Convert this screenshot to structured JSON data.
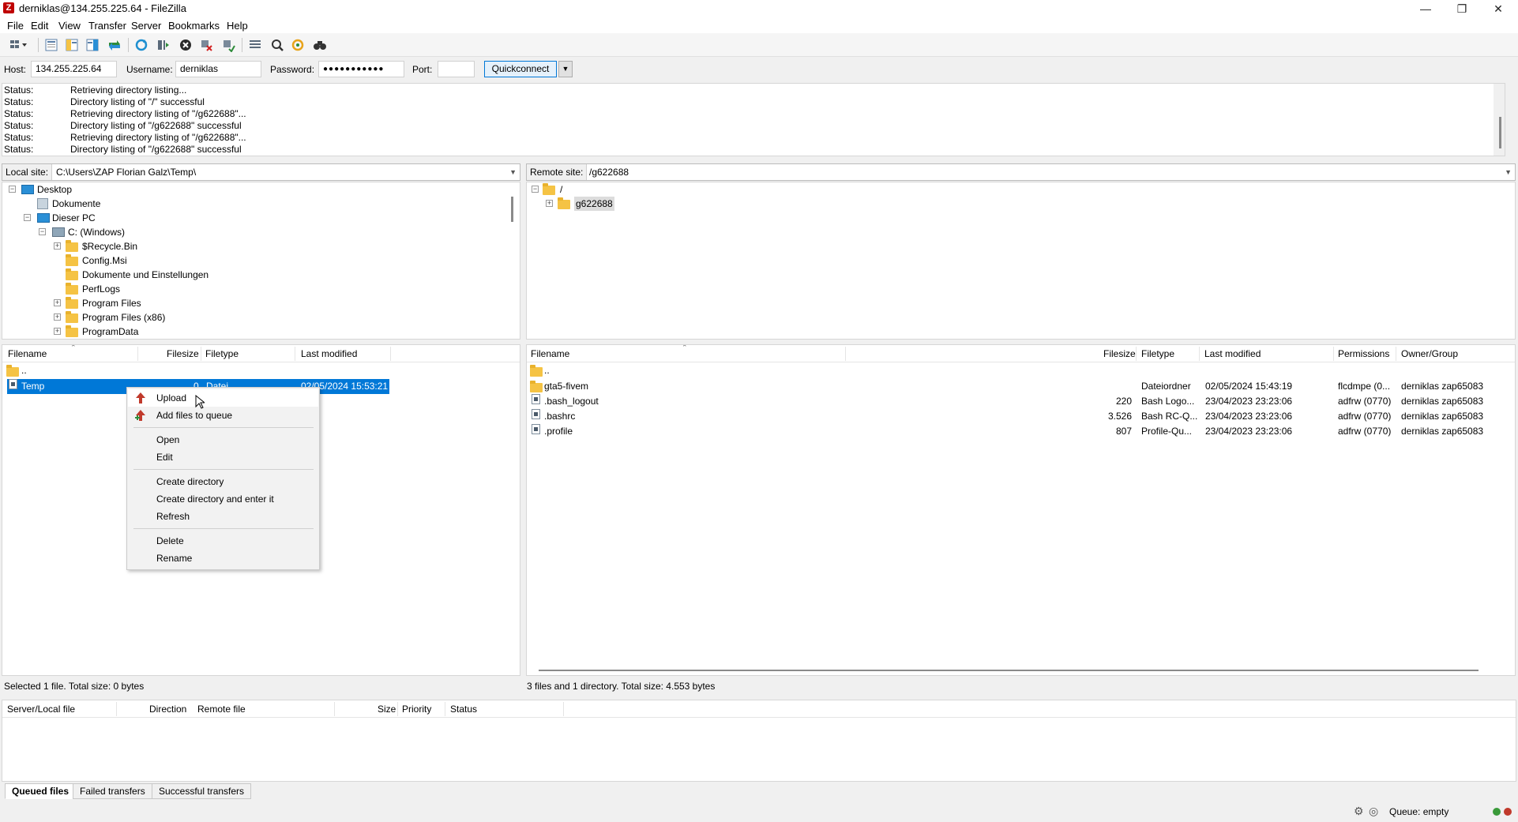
{
  "window": {
    "title": "derniklas@134.255.225.64 - FileZilla",
    "app_icon": "Z",
    "minimize": "—",
    "maximize": "❐",
    "close": "✕"
  },
  "menu": [
    "File",
    "Edit",
    "View",
    "Transfer",
    "Server",
    "Bookmarks",
    "Help"
  ],
  "quickconnect": {
    "host_label": "Host:",
    "host": "134.255.225.64",
    "username_label": "Username:",
    "username": "derniklas",
    "password_label": "Password:",
    "password": "●●●●●●●●●●●",
    "port_label": "Port:",
    "port": "",
    "button": "Quickconnect",
    "dropdown": "▼"
  },
  "log": [
    {
      "key": "Status:",
      "msg": "Retrieving directory listing..."
    },
    {
      "key": "Status:",
      "msg": "Directory listing of \"/\" successful"
    },
    {
      "key": "Status:",
      "msg": "Retrieving directory listing of \"/g622688\"..."
    },
    {
      "key": "Status:",
      "msg": "Directory listing of \"/g622688\" successful"
    },
    {
      "key": "Status:",
      "msg": "Retrieving directory listing of \"/g622688\"..."
    },
    {
      "key": "Status:",
      "msg": "Directory listing of \"/g622688\" successful"
    }
  ],
  "local": {
    "site_label": "Local site:",
    "path": "C:\\Users\\ZAP Florian Galz\\Temp\\",
    "tree": [
      {
        "label": "Desktop",
        "expander": "−",
        "icon": "monitor"
      },
      {
        "label": "Dokumente",
        "expander": "",
        "icon": "doc"
      },
      {
        "label": "Dieser PC",
        "expander": "−",
        "icon": "monitor"
      },
      {
        "label": "C: (Windows)",
        "expander": "−",
        "icon": "drive"
      },
      {
        "label": "$Recycle.Bin",
        "expander": "+",
        "icon": "folder"
      },
      {
        "label": "Config.Msi",
        "expander": "",
        "icon": "folder"
      },
      {
        "label": "Dokumente und Einstellungen",
        "expander": "",
        "icon": "folder"
      },
      {
        "label": "PerfLogs",
        "expander": "",
        "icon": "folder"
      },
      {
        "label": "Program Files",
        "expander": "+",
        "icon": "folder"
      },
      {
        "label": "Program Files (x86)",
        "expander": "+",
        "icon": "folder"
      },
      {
        "label": "ProgramData",
        "expander": "+",
        "icon": "folder"
      }
    ],
    "columns": [
      "Filename",
      "Filesize",
      "Filetype",
      "Last modified"
    ],
    "files": [
      {
        "name": "..",
        "size": "",
        "type": "",
        "modified": ""
      },
      {
        "name": "Temp",
        "size": "0",
        "type": "Datei",
        "modified": "02/05/2024 15:53:21"
      }
    ],
    "status": "Selected 1 file. Total size: 0 bytes"
  },
  "remote": {
    "site_label": "Remote site:",
    "path": "/g622688",
    "tree": [
      {
        "label": "/",
        "expander": "−"
      },
      {
        "label": "g622688",
        "expander": "+"
      }
    ],
    "columns": [
      "Filename",
      "Filesize",
      "Filetype",
      "Last modified",
      "Permissions",
      "Owner/Group"
    ],
    "files": [
      {
        "name": "..",
        "size": "",
        "type": "",
        "modified": "",
        "perms": "",
        "owner": "",
        "icon": "folder"
      },
      {
        "name": "gta5-fivem",
        "size": "",
        "type": "Dateiordner",
        "modified": "02/05/2024 15:43:19",
        "perms": "flcdmpe (0...",
        "owner": "derniklas zap65083",
        "icon": "folder"
      },
      {
        "name": ".bash_logout",
        "size": "220",
        "type": "Bash Logo...",
        "modified": "23/04/2023 23:23:06",
        "perms": "adfrw (0770)",
        "owner": "derniklas zap65083",
        "icon": "file"
      },
      {
        "name": ".bashrc",
        "size": "3.526",
        "type": "Bash RC-Q...",
        "modified": "23/04/2023 23:23:06",
        "perms": "adfrw (0770)",
        "owner": "derniklas zap65083",
        "icon": "file"
      },
      {
        "name": ".profile",
        "size": "807",
        "type": "Profile-Qu...",
        "modified": "23/04/2023 23:23:06",
        "perms": "adfrw (0770)",
        "owner": "derniklas zap65083",
        "icon": "file"
      }
    ],
    "status": "3 files and 1 directory. Total size: 4.553 bytes"
  },
  "context_menu": {
    "upload": "Upload",
    "add_to_queue": "Add files to queue",
    "open": "Open",
    "edit": "Edit",
    "create_dir": "Create directory",
    "create_dir_enter": "Create directory and enter it",
    "refresh": "Refresh",
    "delete": "Delete",
    "rename": "Rename"
  },
  "queue": {
    "columns": [
      "Server/Local file",
      "Direction",
      "Remote file",
      "Size",
      "Priority",
      "Status"
    ],
    "tabs": [
      "Queued files",
      "Failed transfers",
      "Successful transfers"
    ],
    "status": "Queue: empty"
  },
  "colors": {
    "accent": "#0078d7",
    "folder": "#f5c344",
    "upload_arrow": "#c0392b",
    "queue_arrow": "#2e8b3a"
  }
}
